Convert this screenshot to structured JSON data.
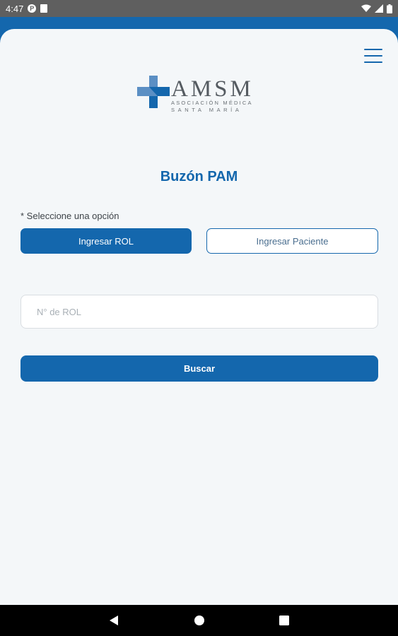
{
  "status_bar": {
    "time": "4:47",
    "notification_icon_letter": "P"
  },
  "logo": {
    "name": "AMSM",
    "line1": "ASOCIACIÓN MÉDICA",
    "line2": "SANTA MARÍA"
  },
  "page": {
    "title": "Buzón PAM",
    "option_label": "* Seleccione una opción"
  },
  "options": {
    "rol_label": "Ingresar ROL",
    "paciente_label": "Ingresar Paciente",
    "selected": "Ingresar ROL"
  },
  "search": {
    "placeholder": "N° de ROL",
    "value": "",
    "button_label": "Buscar"
  },
  "icons": {
    "menu": "hamburger-menu-icon",
    "nav_back": "back-triangle-icon",
    "nav_home": "home-circle-icon",
    "nav_recent": "recent-square-icon"
  },
  "colors": {
    "primary": "#1467ad",
    "background": "#f4f7f9",
    "logo_light": "#5b8fc4"
  }
}
